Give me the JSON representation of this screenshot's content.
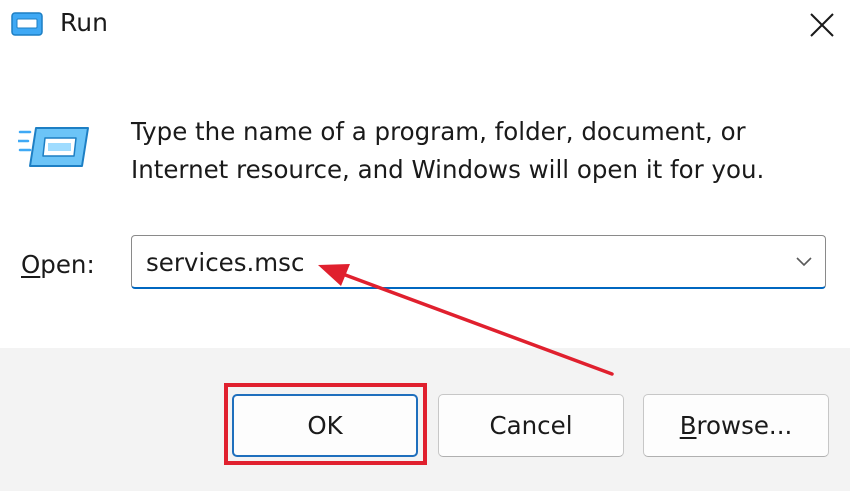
{
  "window": {
    "title": "Run",
    "close_icon": "close-icon"
  },
  "description": {
    "line1": "Type the name of a program, folder, document, or",
    "line2": "Internet resource, and Windows will open it for you."
  },
  "open_field": {
    "label_accel": "O",
    "label_rest": "pen:",
    "value": "services.msc",
    "dropdown_icon": "chevron-down-icon"
  },
  "buttons": {
    "ok": "OK",
    "cancel": "Cancel",
    "browse_accel": "B",
    "browse_rest": "rowse..."
  },
  "colors": {
    "annotation": "#e0202e",
    "focus": "#0067c0"
  }
}
